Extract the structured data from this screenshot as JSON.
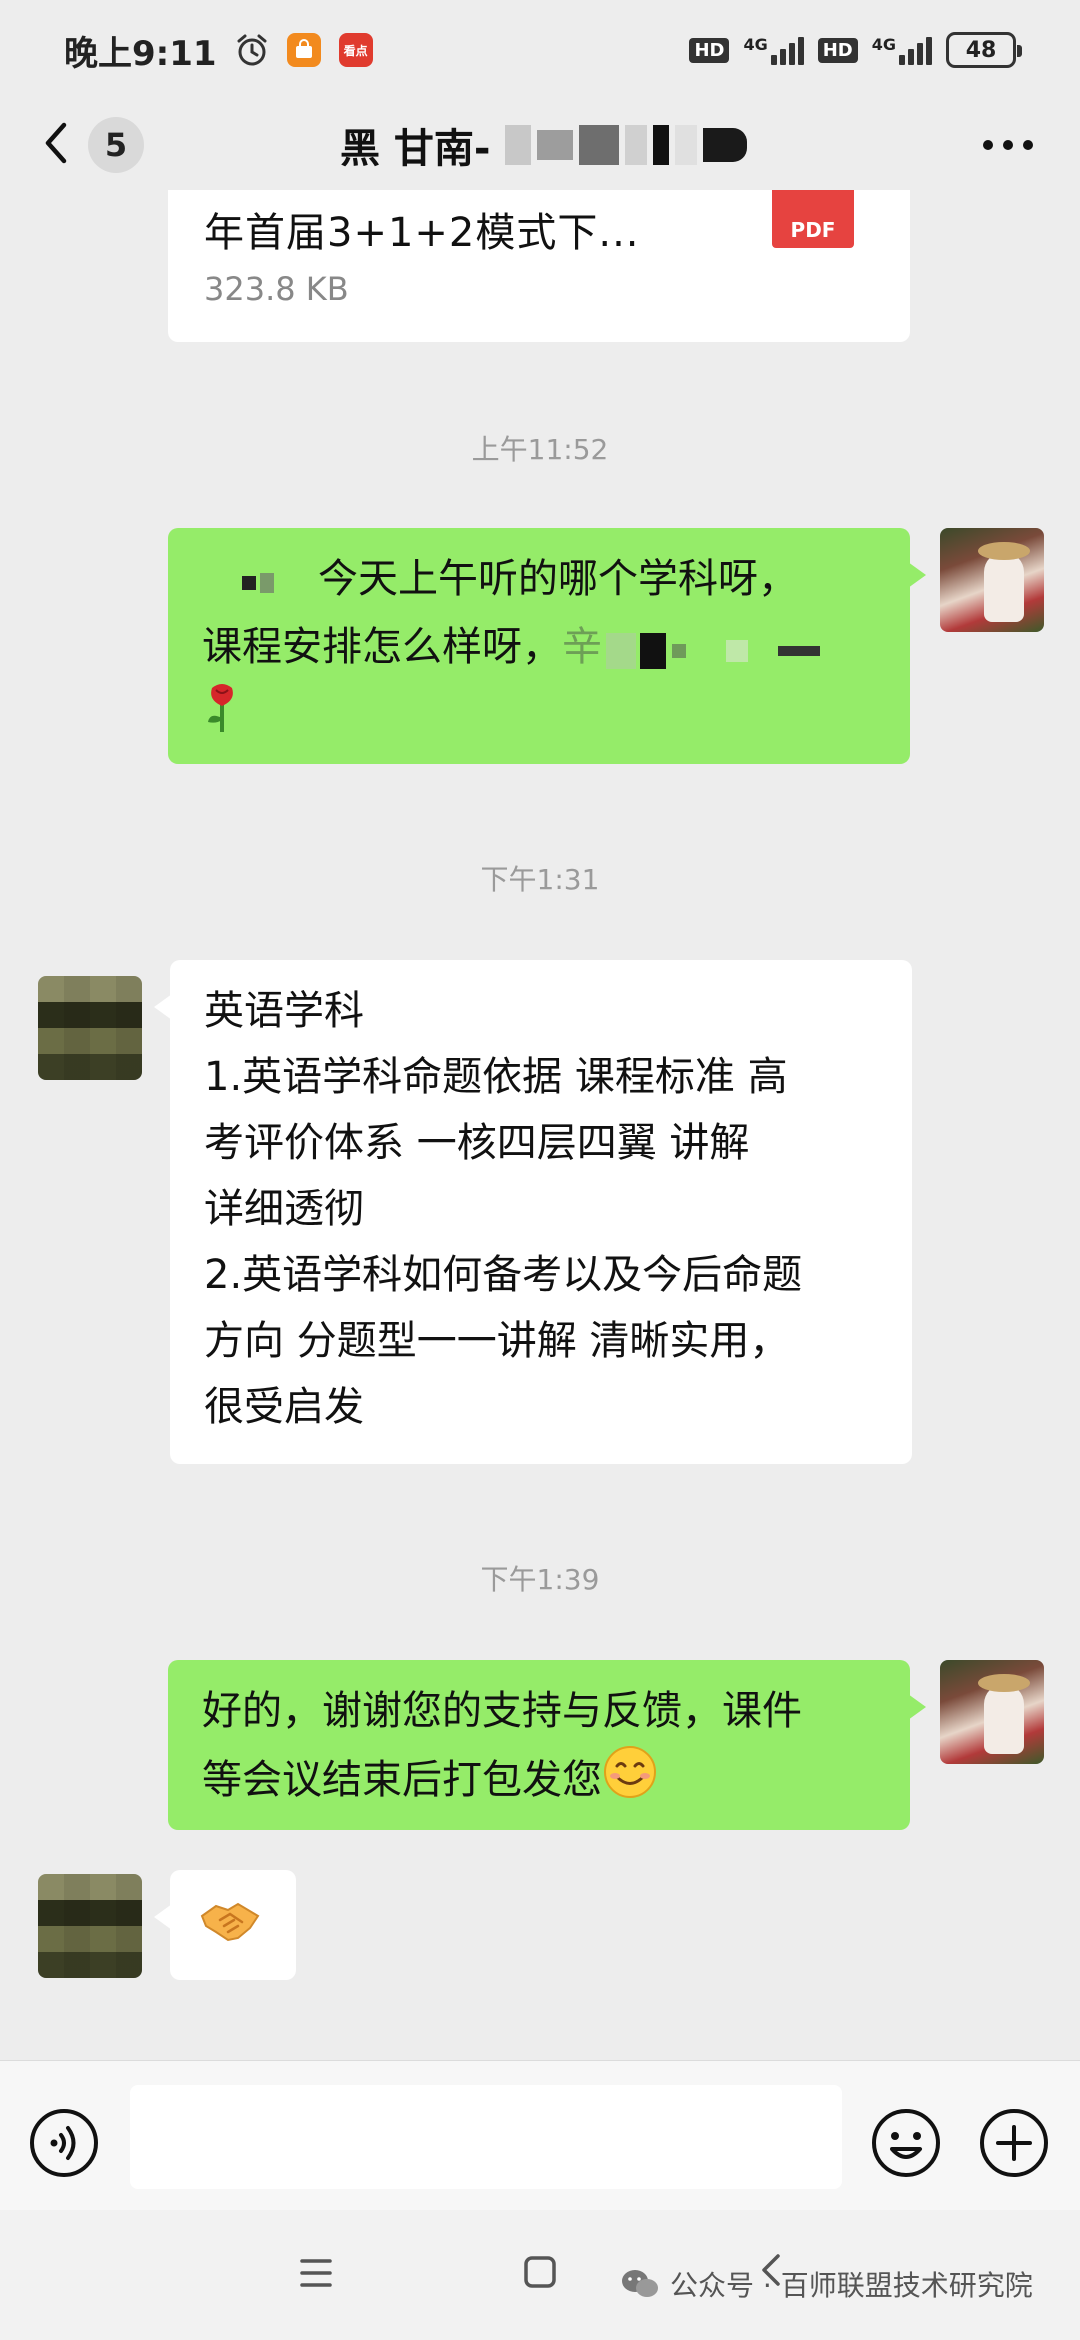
{
  "status_bar": {
    "time": "晚上9:11",
    "badge_red": "看点",
    "hd1": "HD",
    "net1": "4G",
    "hd2": "HD",
    "net2": "4G",
    "battery": "48"
  },
  "header": {
    "unread_count": "5",
    "title": "黑 甘南-"
  },
  "messages": {
    "file": {
      "name": "年首届3+1+2模式下...",
      "size": "323.8 KB",
      "type_label": "PDF"
    },
    "time1": "上午11:52",
    "msg1": {
      "line1": "今天上午听的哪个学科呀，",
      "line2a": "课程安排怎么样呀，",
      "line2b": "辛"
    },
    "time2": "下午1:31",
    "msg2": {
      "lines": [
        "英语学科",
        "1.英语学科命题依据  课程标准   高",
        "考评价体系  一核四层四翼   讲解",
        "详细透彻",
        "2.英语学科如何备考以及今后命题",
        "方向  分题型一一讲解  清晰实用，",
        "很受启发"
      ]
    },
    "time3": "下午1:39",
    "msg3": {
      "line1": "好的，谢谢您的支持与反馈，课件",
      "line2": "等会议结束后打包发您"
    }
  },
  "input": {
    "placeholder": ""
  },
  "watermark": {
    "text": "公众号 · 百师联盟技术研究院"
  },
  "colors": {
    "background": "#ededed",
    "self_bubble": "#95ec69",
    "other_bubble": "#ffffff",
    "timestamp": "#9a9a9a"
  }
}
